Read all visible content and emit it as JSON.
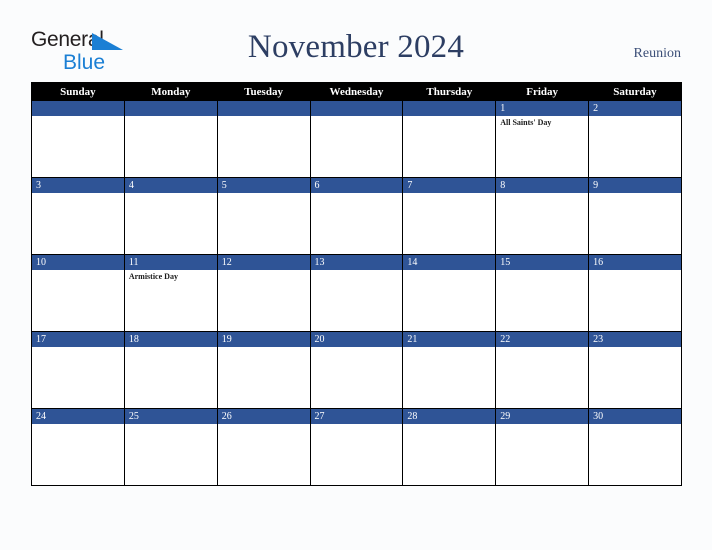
{
  "brand": {
    "name_part1": "General",
    "name_part2": "Blue",
    "triangle_color": "#1b7fd4",
    "text_color": "#231f20"
  },
  "header": {
    "title": "November 2024",
    "region": "Reunion",
    "title_color": "#2d3e63"
  },
  "theme": {
    "page_background": "#fbfcfd",
    "weekday_header_background": "#000000",
    "weekday_header_text": "#ffffff",
    "date_bar_background": "#2f5496",
    "date_bar_text": "#ffffff",
    "cell_background": "#ffffff",
    "grid_line": "#000000",
    "event_text": "#1a1a1a"
  },
  "weekdays": [
    "Sunday",
    "Monday",
    "Tuesday",
    "Wednesday",
    "Thursday",
    "Friday",
    "Saturday"
  ],
  "weeks": [
    [
      {
        "day": "",
        "events": []
      },
      {
        "day": "",
        "events": []
      },
      {
        "day": "",
        "events": []
      },
      {
        "day": "",
        "events": []
      },
      {
        "day": "",
        "events": []
      },
      {
        "day": "1",
        "events": [
          "All Saints' Day"
        ]
      },
      {
        "day": "2",
        "events": []
      }
    ],
    [
      {
        "day": "3",
        "events": []
      },
      {
        "day": "4",
        "events": []
      },
      {
        "day": "5",
        "events": []
      },
      {
        "day": "6",
        "events": []
      },
      {
        "day": "7",
        "events": []
      },
      {
        "day": "8",
        "events": []
      },
      {
        "day": "9",
        "events": []
      }
    ],
    [
      {
        "day": "10",
        "events": []
      },
      {
        "day": "11",
        "events": [
          "Armistice Day"
        ]
      },
      {
        "day": "12",
        "events": []
      },
      {
        "day": "13",
        "events": []
      },
      {
        "day": "14",
        "events": []
      },
      {
        "day": "15",
        "events": []
      },
      {
        "day": "16",
        "events": []
      }
    ],
    [
      {
        "day": "17",
        "events": []
      },
      {
        "day": "18",
        "events": []
      },
      {
        "day": "19",
        "events": []
      },
      {
        "day": "20",
        "events": []
      },
      {
        "day": "21",
        "events": []
      },
      {
        "day": "22",
        "events": []
      },
      {
        "day": "23",
        "events": []
      }
    ],
    [
      {
        "day": "24",
        "events": []
      },
      {
        "day": "25",
        "events": []
      },
      {
        "day": "26",
        "events": []
      },
      {
        "day": "27",
        "events": []
      },
      {
        "day": "28",
        "events": []
      },
      {
        "day": "29",
        "events": []
      },
      {
        "day": "30",
        "events": []
      }
    ]
  ]
}
